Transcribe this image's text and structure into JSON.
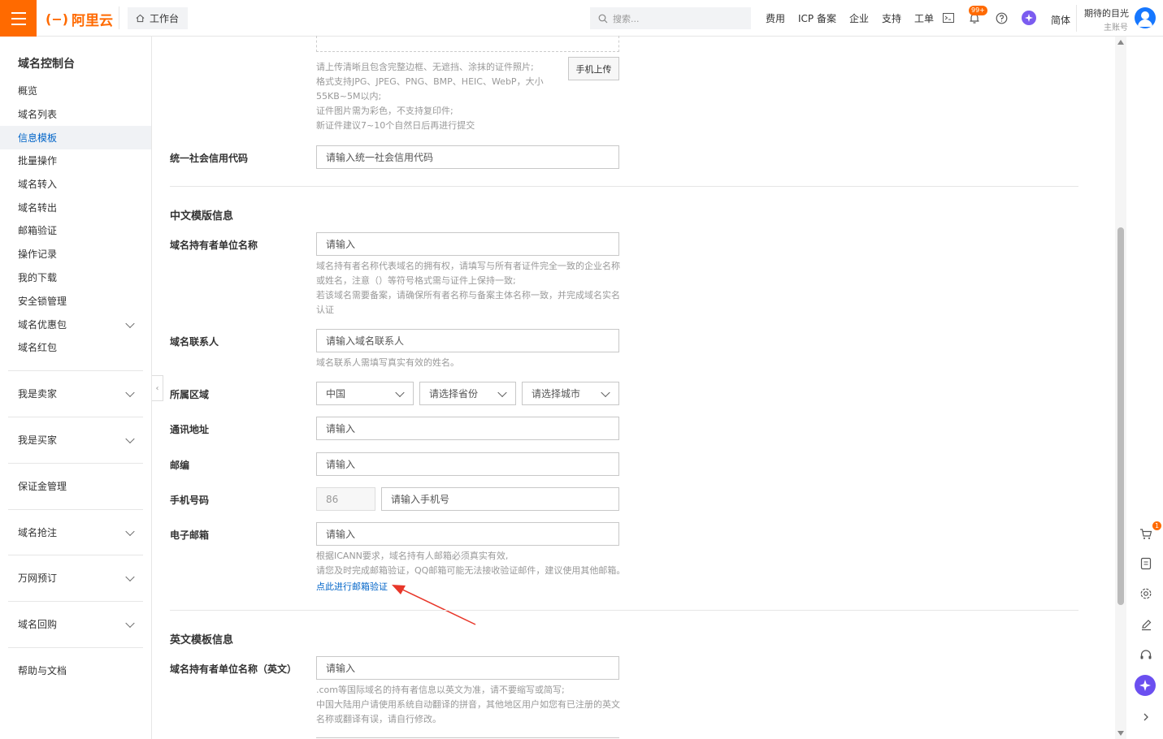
{
  "header": {
    "logo_text": "阿里云",
    "workbench_label": "工作台",
    "search_placeholder": "搜索...",
    "nav": [
      "费用",
      "ICP 备案",
      "企业",
      "支持",
      "工单"
    ],
    "notification_count": "99+",
    "language": "简体",
    "user_name": "期待的目光",
    "user_role": "主账号",
    "accent_color": "#ff6a00"
  },
  "sidebar": {
    "title": "域名控制台",
    "items": [
      {
        "label": "概览",
        "active": false
      },
      {
        "label": "域名列表",
        "active": false
      },
      {
        "label": "信息模板",
        "active": true
      },
      {
        "label": "批量操作",
        "active": false
      },
      {
        "label": "域名转入",
        "active": false
      },
      {
        "label": "域名转出",
        "active": false
      },
      {
        "label": "邮箱验证",
        "active": false
      },
      {
        "label": "操作记录",
        "active": false
      },
      {
        "label": "我的下载",
        "active": false
      },
      {
        "label": "安全锁管理",
        "active": false
      },
      {
        "label": "域名优惠包",
        "active": false,
        "expandable": true
      },
      {
        "label": "域名红包",
        "active": false
      }
    ],
    "groups": [
      {
        "label": "我是卖家",
        "expandable": true
      },
      {
        "label": "我是买家",
        "expandable": true
      },
      {
        "label": "保证金管理",
        "expandable": false
      },
      {
        "label": "域名抢注",
        "expandable": true
      },
      {
        "label": "万网预订",
        "expandable": true
      },
      {
        "label": "域名回购",
        "expandable": true
      },
      {
        "label": "帮助与文档",
        "expandable": false
      }
    ]
  },
  "upload": {
    "hints": [
      "请上传清晰且包含完整边框、无遮挡、涂抹的证件照片;",
      "格式支持JPG、JPEG、PNG、BMP、HEIC、WebP，大小",
      "55KB~5M以内;",
      "证件图片需为彩色，不支持复印件;",
      "新证件建议7~10个自然日后再进行提交"
    ],
    "mobile_upload_button": "手机上传"
  },
  "credit_code": {
    "label": "统一社会信用代码",
    "placeholder": "请输入统一社会信用代码"
  },
  "chinese_section": {
    "title": "中文模版信息",
    "holder": {
      "label": "域名持有者单位名称",
      "placeholder": "请输入",
      "hints": [
        "域名持有者名称代表域名的拥有权，请填写与所有者证件完全一致的企业名称",
        "或姓名，注意（）等符号格式需与证件上保持一致;",
        "若该域名需要备案，请确保所有者名称与备案主体名称一致，并完成域名实名",
        "认证"
      ]
    },
    "contact": {
      "label": "域名联系人",
      "placeholder": "请输入域名联系人",
      "hint": "域名联系人需填写真实有效的姓名。"
    },
    "region": {
      "label": "所属区域",
      "country": "中国",
      "province_placeholder": "请选择省份",
      "city_placeholder": "请选择城市"
    },
    "address": {
      "label": "通讯地址",
      "placeholder": "请输入"
    },
    "postcode": {
      "label": "邮编",
      "placeholder": "请输入"
    },
    "phone": {
      "label": "手机号码",
      "country_code": "86",
      "placeholder": "请输入手机号"
    },
    "email": {
      "label": "电子邮箱",
      "placeholder": "请输入",
      "hints": [
        "根据ICANN要求，域名持有人邮箱必须真实有效,",
        "请您及时完成邮箱验证，QQ邮箱可能无法接收验证邮件，建议使用其他邮箱。"
      ],
      "verify_link": "点此进行邮箱验证"
    }
  },
  "english_section": {
    "title": "英文模板信息",
    "holder": {
      "label": "域名持有者单位名称（英文）",
      "placeholder": "请输入",
      "hints": [
        ".com等国际域名的持有者信息以英文为准，请不要缩写或简写;",
        "中国大陆用户请使用系统自动翻译的拼音，其他地区用户如您有已注册的英文",
        "名称或翻译有误，请自行修改。"
      ]
    }
  },
  "right_tools": {
    "cart_count": "1",
    "icons": [
      "cart-icon",
      "document-icon",
      "settings-icon",
      "edit-icon",
      "headset-icon",
      "ai-assistant-icon",
      "expand-icon"
    ]
  }
}
